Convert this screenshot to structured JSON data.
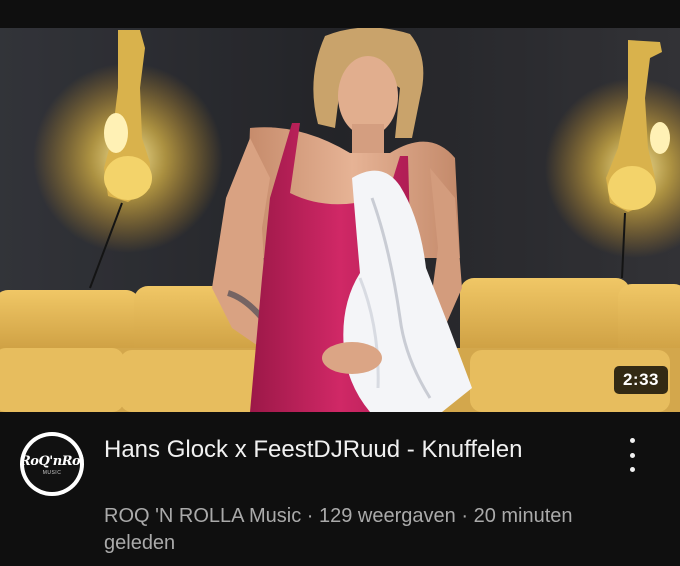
{
  "video": {
    "duration": "2:33",
    "title": "Hans Glock x FeestDJRuud - Knuffelen",
    "channel": "ROQ 'N ROLLA Music",
    "separator": "·",
    "views": "129 weergaven",
    "uploaded": "20 minuten geleden"
  },
  "avatar": {
    "logo_text": "RoQ'nRolla",
    "logo_sub": "MUSIC"
  },
  "icons": {
    "more": "more-vert-icon"
  },
  "colors": {
    "background": "#0f0f0f",
    "title_text": "#f1f1f1",
    "meta_text": "#aaaaaa",
    "sofa": "#e3b95a",
    "dress": "#c21f5b",
    "wall": "#2e2f33",
    "lamp_glow": "#ffd24a"
  }
}
